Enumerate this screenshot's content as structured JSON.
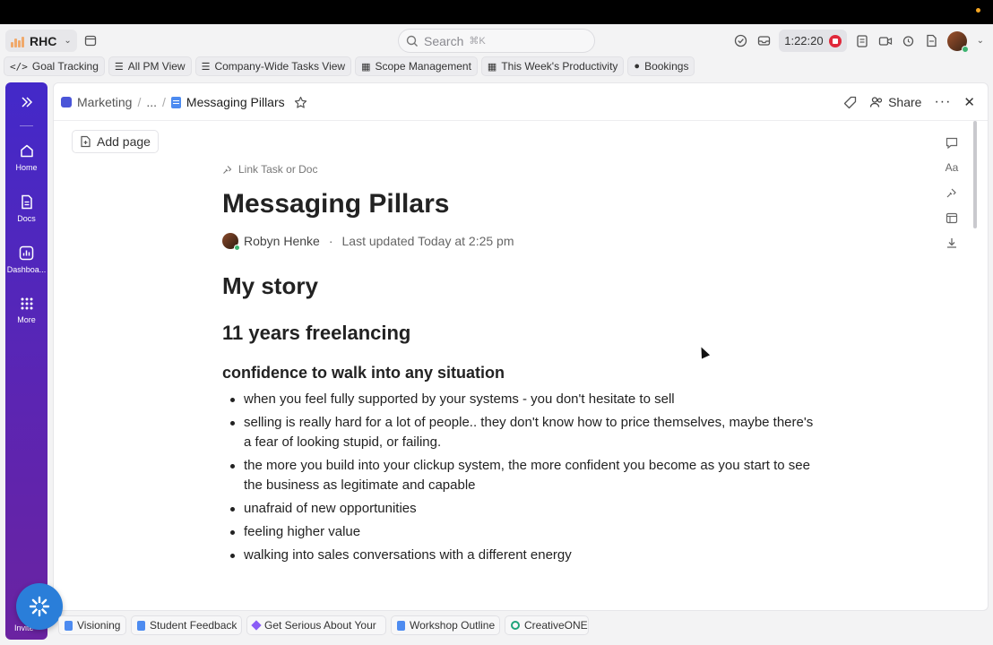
{
  "topbar": {
    "workspace": "RHC",
    "search_placeholder": "Search",
    "search_shortcut": "⌘K",
    "timer": "1:22:20"
  },
  "favorites": [
    {
      "label": "Goal Tracking",
      "icon": "code-icon"
    },
    {
      "label": "All PM View",
      "icon": "checklist-icon"
    },
    {
      "label": "Company-Wide Tasks View",
      "icon": "checklist-icon"
    },
    {
      "label": "Scope Management",
      "icon": "dashboard-icon"
    },
    {
      "label": "This Week's Productivity",
      "icon": "dashboard-icon"
    },
    {
      "label": "Bookings",
      "icon": "mic-icon"
    }
  ],
  "sidebar": {
    "items": [
      {
        "label": "Home",
        "icon": "home-icon"
      },
      {
        "label": "Docs",
        "icon": "docs-icon"
      },
      {
        "label": "Dashboa...",
        "icon": "dashboards-icon"
      },
      {
        "label": "More",
        "icon": "grid-icon"
      }
    ],
    "invite": "Invite"
  },
  "doc_header": {
    "breadcrumb_space": "Marketing",
    "breadcrumb_ellipsis": "...",
    "breadcrumb_current": "Messaging Pillars",
    "share_label": "Share"
  },
  "doc": {
    "add_page": "Add page",
    "link_task": "Link Task or Doc",
    "title": "Messaging Pillars",
    "author": "Robyn Henke",
    "updated": "Last updated Today at 2:25 pm",
    "h1": "My story",
    "h2": "11 years freelancing",
    "h3": "confidence to walk into any situation",
    "bullets": [
      "when you feel fully supported by your systems - you don't hesitate to sell",
      "selling is really hard for a lot of people.. they don't know how to price themselves, maybe there's a fear of looking stupid, or failing.",
      "the more you build into your clickup system, the more confident you become as you start to see the business as legitimate and capable",
      "unafraid of new opportunities",
      "feeling higher value",
      "walking into sales conversations with a different energy"
    ]
  },
  "tray": [
    {
      "label": "Visioning",
      "icon": "doc-icon"
    },
    {
      "label": "Student Feedback",
      "icon": "doc-icon"
    },
    {
      "label": "Get Serious About Your",
      "icon": "diamond-icon"
    },
    {
      "label": "Workshop Outline",
      "icon": "doc-icon"
    },
    {
      "label": "CreativeONE",
      "icon": "circle-icon"
    }
  ],
  "colors": {
    "sidebar_top": "#4329c9",
    "sidebar_bottom": "#6a23a1",
    "fab": "#2a7ed9",
    "record": "#e0283a"
  }
}
